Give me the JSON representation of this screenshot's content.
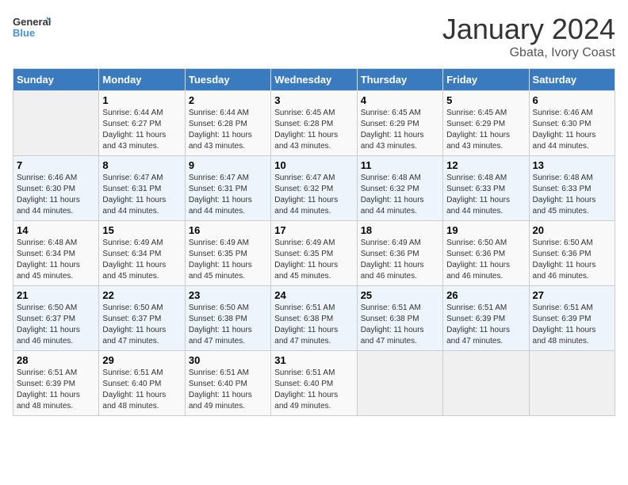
{
  "header": {
    "logo_text_general": "General",
    "logo_text_blue": "Blue",
    "month_title": "January 2024",
    "location": "Gbata, Ivory Coast"
  },
  "days_of_week": [
    "Sunday",
    "Monday",
    "Tuesday",
    "Wednesday",
    "Thursday",
    "Friday",
    "Saturday"
  ],
  "weeks": [
    [
      {
        "day": "",
        "content": ""
      },
      {
        "day": "1",
        "content": "Sunrise: 6:44 AM\nSunset: 6:27 PM\nDaylight: 11 hours\nand 43 minutes."
      },
      {
        "day": "2",
        "content": "Sunrise: 6:44 AM\nSunset: 6:28 PM\nDaylight: 11 hours\nand 43 minutes."
      },
      {
        "day": "3",
        "content": "Sunrise: 6:45 AM\nSunset: 6:28 PM\nDaylight: 11 hours\nand 43 minutes."
      },
      {
        "day": "4",
        "content": "Sunrise: 6:45 AM\nSunset: 6:29 PM\nDaylight: 11 hours\nand 43 minutes."
      },
      {
        "day": "5",
        "content": "Sunrise: 6:45 AM\nSunset: 6:29 PM\nDaylight: 11 hours\nand 43 minutes."
      },
      {
        "day": "6",
        "content": "Sunrise: 6:46 AM\nSunset: 6:30 PM\nDaylight: 11 hours\nand 44 minutes."
      }
    ],
    [
      {
        "day": "7",
        "content": "Sunrise: 6:46 AM\nSunset: 6:30 PM\nDaylight: 11 hours\nand 44 minutes."
      },
      {
        "day": "8",
        "content": "Sunrise: 6:47 AM\nSunset: 6:31 PM\nDaylight: 11 hours\nand 44 minutes."
      },
      {
        "day": "9",
        "content": "Sunrise: 6:47 AM\nSunset: 6:31 PM\nDaylight: 11 hours\nand 44 minutes."
      },
      {
        "day": "10",
        "content": "Sunrise: 6:47 AM\nSunset: 6:32 PM\nDaylight: 11 hours\nand 44 minutes."
      },
      {
        "day": "11",
        "content": "Sunrise: 6:48 AM\nSunset: 6:32 PM\nDaylight: 11 hours\nand 44 minutes."
      },
      {
        "day": "12",
        "content": "Sunrise: 6:48 AM\nSunset: 6:33 PM\nDaylight: 11 hours\nand 44 minutes."
      },
      {
        "day": "13",
        "content": "Sunrise: 6:48 AM\nSunset: 6:33 PM\nDaylight: 11 hours\nand 45 minutes."
      }
    ],
    [
      {
        "day": "14",
        "content": "Sunrise: 6:48 AM\nSunset: 6:34 PM\nDaylight: 11 hours\nand 45 minutes."
      },
      {
        "day": "15",
        "content": "Sunrise: 6:49 AM\nSunset: 6:34 PM\nDaylight: 11 hours\nand 45 minutes."
      },
      {
        "day": "16",
        "content": "Sunrise: 6:49 AM\nSunset: 6:35 PM\nDaylight: 11 hours\nand 45 minutes."
      },
      {
        "day": "17",
        "content": "Sunrise: 6:49 AM\nSunset: 6:35 PM\nDaylight: 11 hours\nand 45 minutes."
      },
      {
        "day": "18",
        "content": "Sunrise: 6:49 AM\nSunset: 6:36 PM\nDaylight: 11 hours\nand 46 minutes."
      },
      {
        "day": "19",
        "content": "Sunrise: 6:50 AM\nSunset: 6:36 PM\nDaylight: 11 hours\nand 46 minutes."
      },
      {
        "day": "20",
        "content": "Sunrise: 6:50 AM\nSunset: 6:36 PM\nDaylight: 11 hours\nand 46 minutes."
      }
    ],
    [
      {
        "day": "21",
        "content": "Sunrise: 6:50 AM\nSunset: 6:37 PM\nDaylight: 11 hours\nand 46 minutes."
      },
      {
        "day": "22",
        "content": "Sunrise: 6:50 AM\nSunset: 6:37 PM\nDaylight: 11 hours\nand 47 minutes."
      },
      {
        "day": "23",
        "content": "Sunrise: 6:50 AM\nSunset: 6:38 PM\nDaylight: 11 hours\nand 47 minutes."
      },
      {
        "day": "24",
        "content": "Sunrise: 6:51 AM\nSunset: 6:38 PM\nDaylight: 11 hours\nand 47 minutes."
      },
      {
        "day": "25",
        "content": "Sunrise: 6:51 AM\nSunset: 6:38 PM\nDaylight: 11 hours\nand 47 minutes."
      },
      {
        "day": "26",
        "content": "Sunrise: 6:51 AM\nSunset: 6:39 PM\nDaylight: 11 hours\nand 47 minutes."
      },
      {
        "day": "27",
        "content": "Sunrise: 6:51 AM\nSunset: 6:39 PM\nDaylight: 11 hours\nand 48 minutes."
      }
    ],
    [
      {
        "day": "28",
        "content": "Sunrise: 6:51 AM\nSunset: 6:39 PM\nDaylight: 11 hours\nand 48 minutes."
      },
      {
        "day": "29",
        "content": "Sunrise: 6:51 AM\nSunset: 6:40 PM\nDaylight: 11 hours\nand 48 minutes."
      },
      {
        "day": "30",
        "content": "Sunrise: 6:51 AM\nSunset: 6:40 PM\nDaylight: 11 hours\nand 49 minutes."
      },
      {
        "day": "31",
        "content": "Sunrise: 6:51 AM\nSunset: 6:40 PM\nDaylight: 11 hours\nand 49 minutes."
      },
      {
        "day": "",
        "content": ""
      },
      {
        "day": "",
        "content": ""
      },
      {
        "day": "",
        "content": ""
      }
    ]
  ]
}
